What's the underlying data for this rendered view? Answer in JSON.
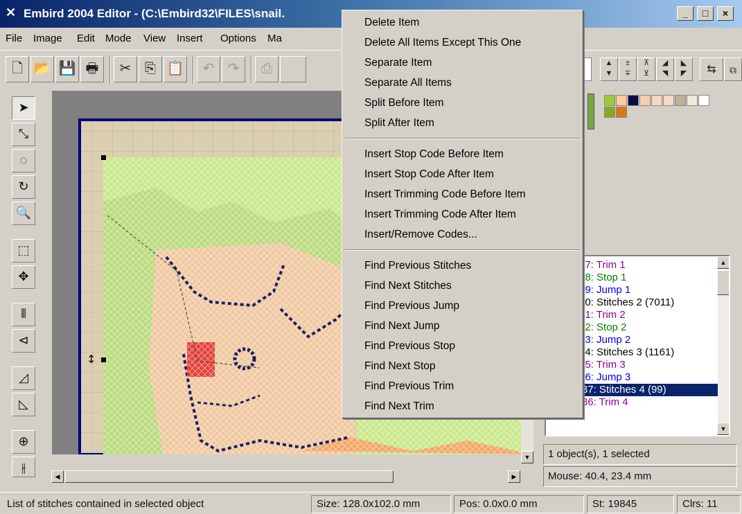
{
  "window": {
    "title": "Embird 2004 Editor - (C:\\Embird32\\FILES\\snail.",
    "app_icon": "needle-icon",
    "buttons": [
      "minimize",
      "maximize",
      "close"
    ]
  },
  "menubar": [
    "File",
    "Image",
    "Edit",
    "Mode",
    "View",
    "Insert",
    "Options",
    "Ma"
  ],
  "context_menu": {
    "group1": [
      "Delete Item",
      "Delete All Items Except This One",
      "Separate Item",
      "Separate All Items",
      "Split Before Item",
      "Split After Item"
    ],
    "group2": [
      "Insert Stop Code Before Item",
      "Insert Stop Code After Item",
      "Insert Trimming Code Before Item",
      "Insert Trimming Code After Item",
      "Insert/Remove Codes..."
    ],
    "group3": [
      "Find Previous Stitches",
      "Find Next Stitches",
      "Find Previous Jump",
      "Find Next Jump",
      "Find Previous Stop",
      "Find Next Stop",
      "Find Previous Trim",
      "Find Next Trim"
    ]
  },
  "stitch_list": [
    {
      "text": "57:  Trim 1",
      "kind": "trim"
    },
    {
      "text": "58:  Stop 1",
      "kind": "stop"
    },
    {
      "text": "59:  Jump 1",
      "kind": "jump"
    },
    {
      "text": "60:  Stitches 2 (7011)",
      "kind": "stitch"
    },
    {
      "text": "71:  Trim 2",
      "kind": "trim"
    },
    {
      "text": "72:  Stop 2",
      "kind": "stop"
    },
    {
      "text": "73:  Jump 2",
      "kind": "jump"
    },
    {
      "text": "74:  Stitches 3 (1161)",
      "kind": "stitch"
    },
    {
      "text": "35:  Trim 3",
      "kind": "trim"
    },
    {
      "text": "36:  Jump 3",
      "kind": "jump"
    },
    {
      "text": "11237:  Stitches 4 (99)",
      "kind": "stitch",
      "selected": true
    },
    {
      "text": "11336:  Trim 4",
      "kind": "trim"
    }
  ],
  "info": {
    "selection": "1 object(s), 1 selected",
    "mouse": "Mouse: 40.4, 23.4 mm"
  },
  "status": {
    "hint": "List of stitches contained in selected object",
    "size": "Size: 128.0x102.0 mm",
    "pos": "Pos: 0.0x0.0 mm",
    "stitches": "St: 19845",
    "colors": "Clrs: 11"
  },
  "palette_colors": [
    "#99cc33",
    "#ffcc99",
    "#0a0a4a",
    "#f5d0b0",
    "#f5d8c0",
    "#f5dcc8",
    "#c0b098",
    "#f0e8e0",
    "#ffffff",
    "#88aa22",
    "#dd7711"
  ],
  "colors": {
    "fabric": "#dccfb0",
    "grass": "#c8e88a",
    "snail_body": "#f0c8a0",
    "outline_thread": "#1a2060",
    "eye_thread": "#e02020",
    "frame": "#000080"
  }
}
